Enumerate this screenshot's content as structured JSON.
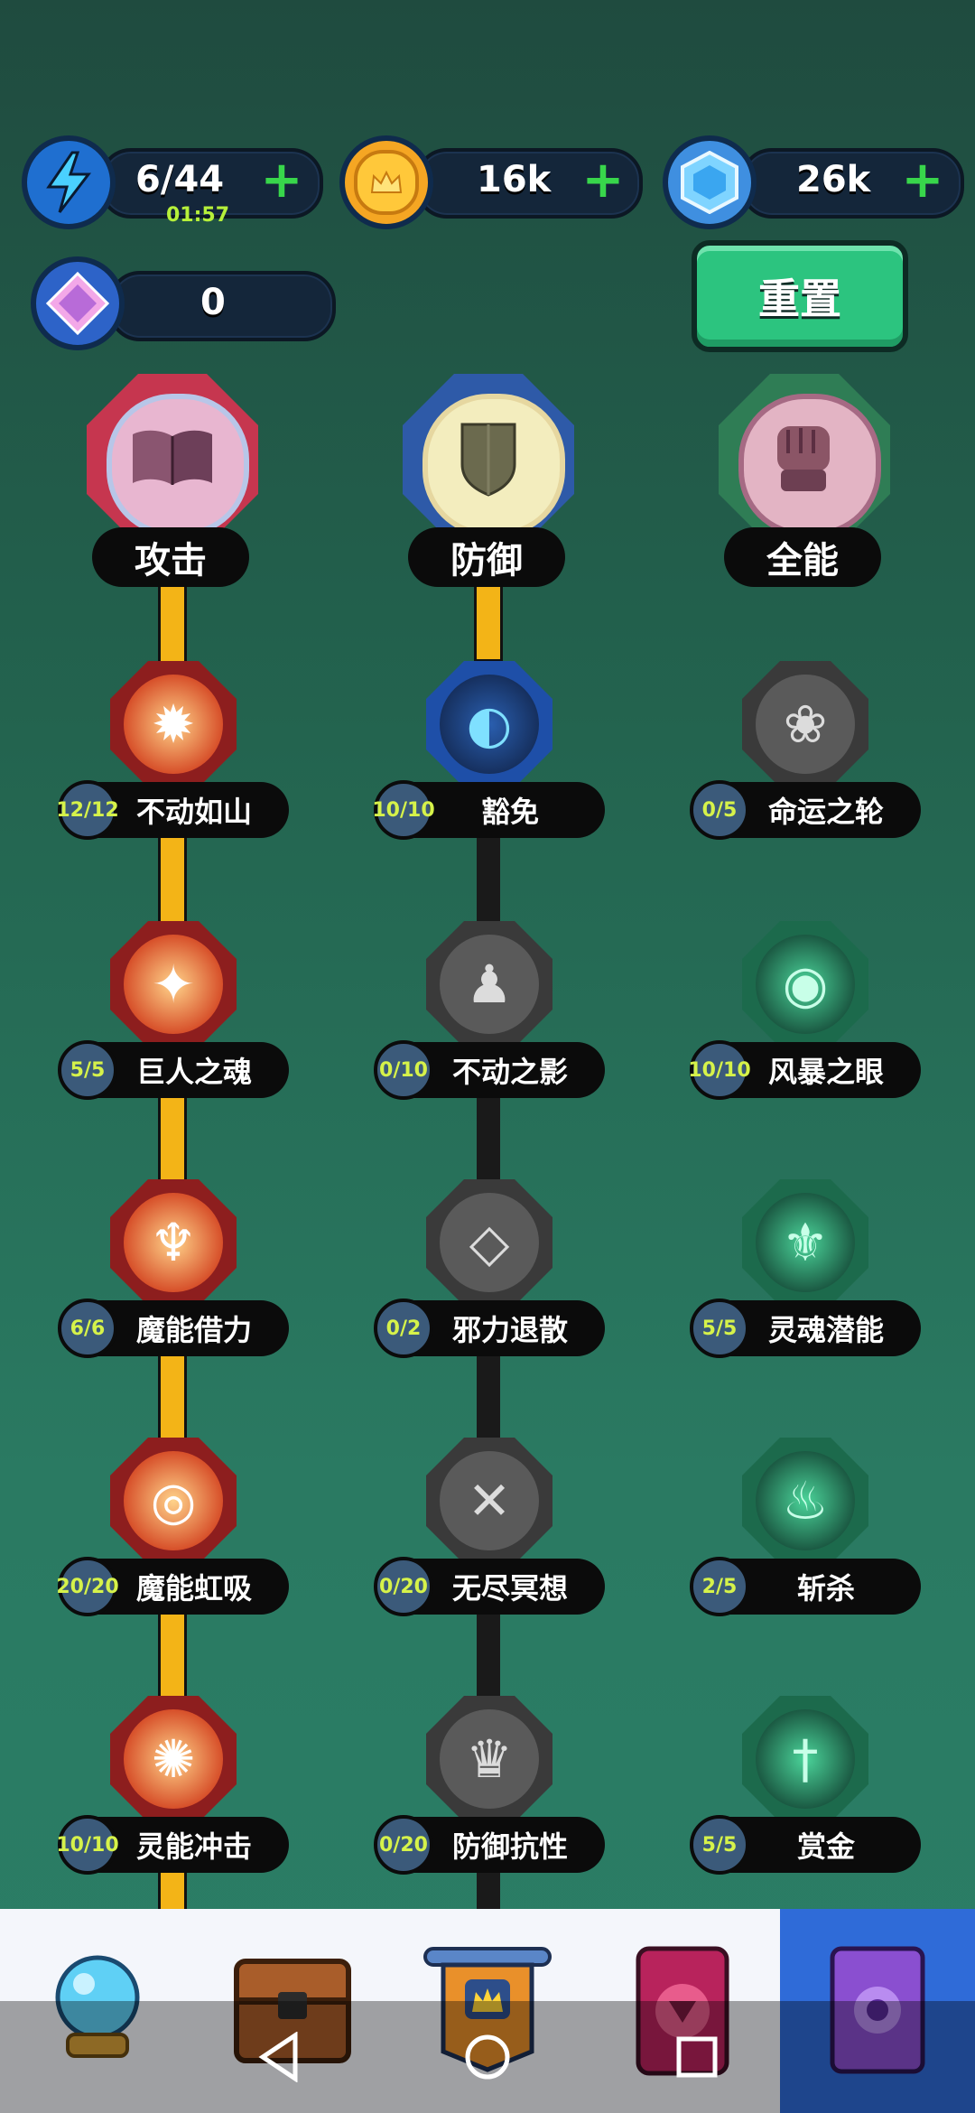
{
  "resources": {
    "energy": {
      "value": "6/44",
      "timer": "01:57",
      "icon": "lightning-icon"
    },
    "coins": {
      "value": "16k",
      "icon": "crown-coin-icon"
    },
    "gems": {
      "value": "26k",
      "icon": "hex-gem-icon"
    },
    "crystals": {
      "value": "0",
      "icon": "diamond-icon"
    },
    "plus_label": "+"
  },
  "reset_label": "重置",
  "categories": [
    {
      "label": "攻击",
      "icon": "book-icon",
      "color": "#c6364f"
    },
    {
      "label": "防御",
      "icon": "shield-icon",
      "color": "#2e5aa8"
    },
    {
      "label": "全能",
      "icon": "fist-icon",
      "color": "#2f7d55"
    }
  ],
  "skills": {
    "attack": [
      {
        "name": "不动如山",
        "level": "12/12",
        "icon": "flame-crest-icon"
      },
      {
        "name": "巨人之魂",
        "level": "5/5",
        "icon": "titan-icon"
      },
      {
        "name": "魔能借力",
        "level": "6/6",
        "icon": "wings-icon"
      },
      {
        "name": "魔能虹吸",
        "level": "20/20",
        "icon": "vortex-icon"
      },
      {
        "name": "灵能冲击",
        "level": "10/10",
        "icon": "burst-icon"
      }
    ],
    "defense": [
      {
        "name": "豁免",
        "level": "10/10",
        "icon": "orbit-icon"
      },
      {
        "name": "不动之影",
        "level": "0/10",
        "icon": "shadow-icon"
      },
      {
        "name": "邪力退散",
        "level": "0/2",
        "icon": "diamond-ward-icon"
      },
      {
        "name": "无尽冥想",
        "level": "0/20",
        "icon": "eye-slash-icon"
      },
      {
        "name": "防御抗性",
        "level": "0/20",
        "icon": "cloak-icon"
      }
    ],
    "universal": [
      {
        "name": "命运之轮",
        "level": "0/5",
        "icon": "lotus-icon"
      },
      {
        "name": "风暴之眼",
        "level": "10/10",
        "icon": "storm-eye-icon"
      },
      {
        "name": "灵魂潜能",
        "level": "5/5",
        "icon": "fleur-icon"
      },
      {
        "name": "斩杀",
        "level": "2/5",
        "icon": "claw-icon"
      },
      {
        "name": "赏金",
        "level": "5/5",
        "icon": "sword-icon"
      }
    ]
  },
  "nav": [
    {
      "name": "crystal-ball-icon"
    },
    {
      "name": "chest-icon"
    },
    {
      "name": "banner-icon"
    },
    {
      "name": "card-icon"
    },
    {
      "name": "talent-book-icon"
    }
  ],
  "colors": {
    "attack_line": "#f3b417",
    "defense_line_active": "#f3b417",
    "defense_line_inactive": "#1a1a1a",
    "attack_node": "#a62a2a",
    "defense_active_node": "#1e4fa8",
    "inactive_node": "#4d4d4d",
    "universal_node": "#1c6a4c",
    "nav_active": "#2f6bd8"
  }
}
